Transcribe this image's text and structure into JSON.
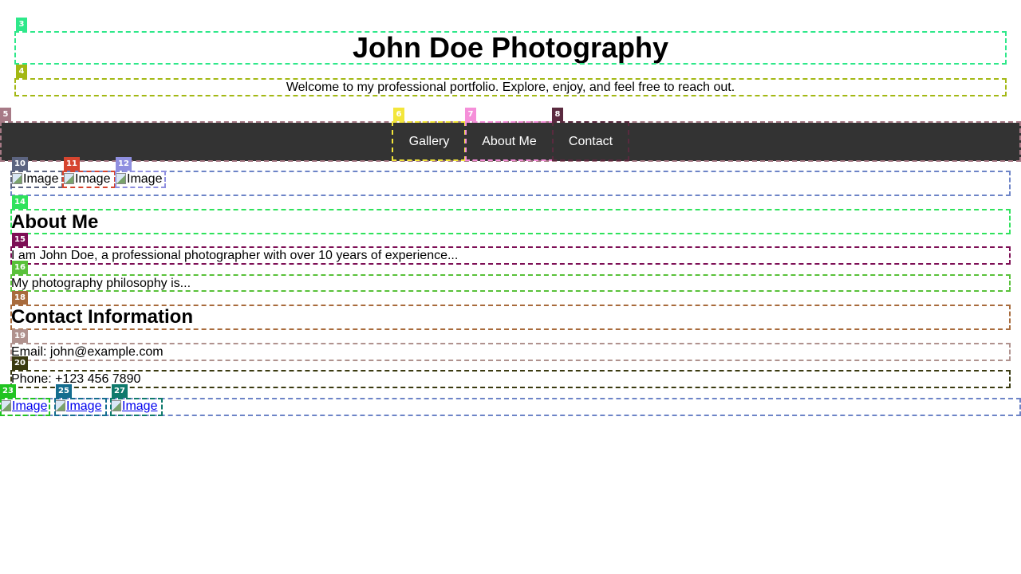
{
  "header": {
    "title": "John Doe Photography",
    "subtitle": "Welcome to my professional portfolio. Explore, enjoy, and feel free to reach out."
  },
  "nav": {
    "items": [
      {
        "label": "Gallery"
      },
      {
        "label": "About Me"
      },
      {
        "label": "Contact"
      }
    ]
  },
  "gallery": {
    "images": [
      {
        "alt": "Image"
      },
      {
        "alt": "Image"
      },
      {
        "alt": "Image"
      }
    ]
  },
  "about": {
    "heading": "About Me",
    "paragraphs": [
      "I am John Doe, a professional photographer with over 10 years of experience...",
      "My photography philosophy is..."
    ]
  },
  "contact": {
    "heading": "Contact Information",
    "email": "Email: john@example.com",
    "phone": "Phone: +123 456 7890"
  },
  "footer": {
    "images": [
      {
        "alt": "Image"
      },
      {
        "alt": "Image"
      },
      {
        "alt": "Image"
      }
    ]
  },
  "overlay_markers": [
    "3",
    "4",
    "5",
    "6",
    "7",
    "8",
    "10",
    "11",
    "12",
    "14",
    "15",
    "16",
    "18",
    "19",
    "20",
    "23",
    "25",
    "27"
  ],
  "colors": {
    "nav_background": "#333333",
    "nav_text": "#ffffff",
    "link": "#0000ee"
  }
}
